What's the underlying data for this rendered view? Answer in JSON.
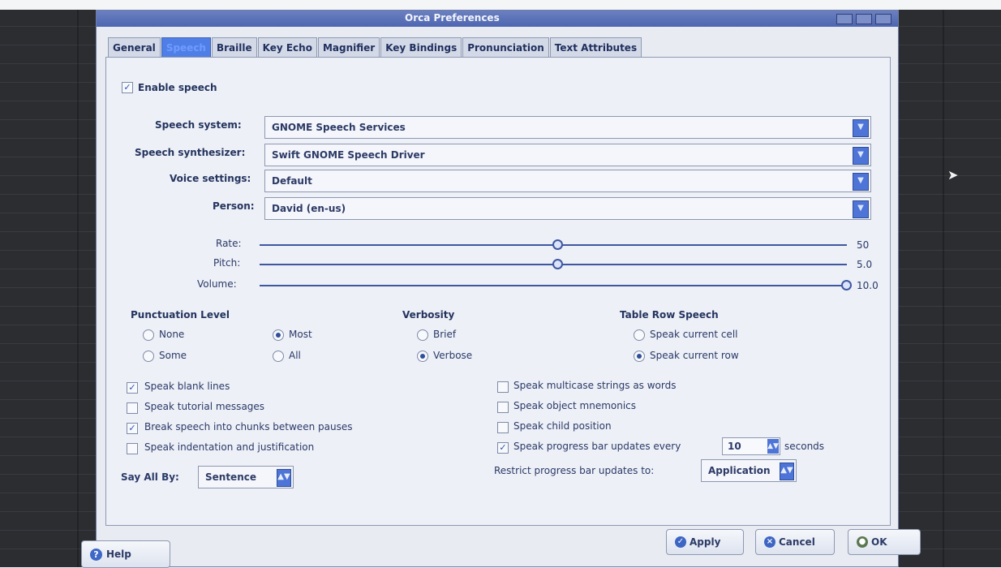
{
  "window": {
    "title": "Orca Preferences"
  },
  "tabs": [
    {
      "label": "General"
    },
    {
      "label": "Speech"
    },
    {
      "label": "Braille"
    },
    {
      "label": "Key Echo"
    },
    {
      "label": "Magnifier"
    },
    {
      "label": "Key Bindings"
    },
    {
      "label": "Pronunciation"
    },
    {
      "label": "Text Attributes"
    }
  ],
  "enable_speech": {
    "label": "Enable speech",
    "checked": true
  },
  "speech": {
    "system_label": "Speech system:",
    "system_value": "GNOME Speech Services",
    "synthesizer_label": "Speech synthesizer:",
    "synthesizer_value": "Swift GNOME Speech Driver",
    "voice_settings_label": "Voice settings:",
    "voice_settings_value": "Default",
    "person_label": "Person:",
    "person_value": "David (en-us)"
  },
  "sliders": {
    "rate_label": "Rate:",
    "rate_value": "50",
    "pitch_label": "Pitch:",
    "pitch_value": "5.0",
    "volume_label": "Volume:",
    "volume_value": "10.0"
  },
  "punctuation": {
    "title": "Punctuation Level",
    "none": "None",
    "some": "Some",
    "most": "Most",
    "all": "All"
  },
  "verbosity": {
    "title": "Verbosity",
    "brief": "Brief",
    "verbose": "Verbose"
  },
  "table_row_speech": {
    "title": "Table Row Speech",
    "current_cell": "Speak current cell",
    "current_row": "Speak current row"
  },
  "options_left": {
    "speak_blank_lines": "Speak blank lines",
    "speak_tutorial_messages": "Speak tutorial messages",
    "break_speech": "Break speech into chunks between pauses",
    "speak_indentation": "Speak indentation and justification",
    "say_all_by_label": "Say All By:",
    "say_all_by_value": "Sentence"
  },
  "options_right": {
    "multicase": "Speak multicase strings as words",
    "mnemonics": "Speak object mnemonics",
    "child_position": "Speak child position",
    "progress_updates_prefix": "Speak progress bar updates every",
    "progress_interval": "10",
    "seconds": "seconds",
    "restrict_label": "Restrict progress bar updates to:",
    "restrict_value": "Application"
  },
  "buttons": {
    "help": "Help",
    "apply": "Apply",
    "cancel": "Cancel",
    "ok": "OK"
  }
}
